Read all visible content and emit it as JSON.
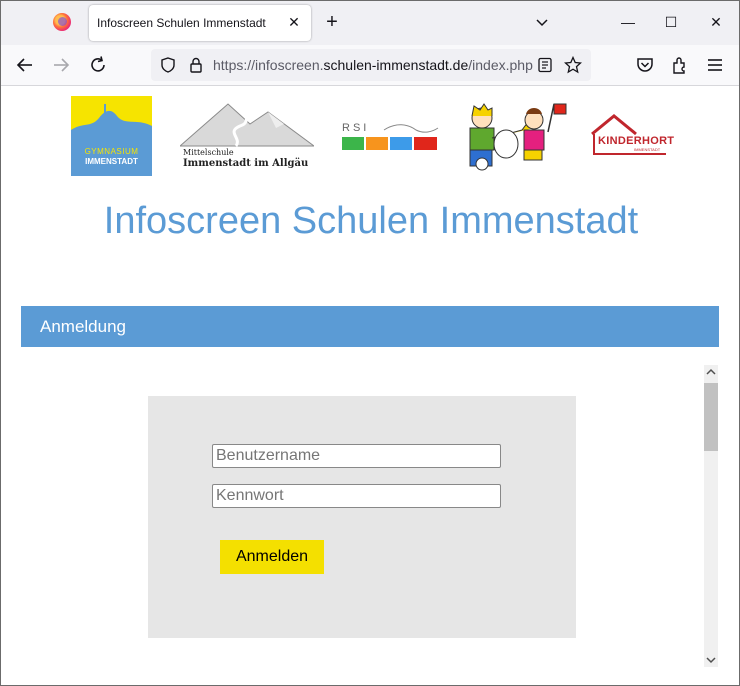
{
  "browser": {
    "tab_title": "Infoscreen Schulen Immenstadt",
    "tab_close": "✕",
    "new_tab": "+",
    "url_prefix": "https://infoscreen.",
    "url_domain": "schulen-immenstadt.de",
    "url_path": "/index.php",
    "window_min": "—",
    "window_max": "☐",
    "window_close": "✕"
  },
  "logos": {
    "gymnasium_line1": "GYMNASIUM",
    "gymnasium_line2": "IMMENSTADT",
    "mittelschule_line1": "Mittelschule",
    "mittelschule_line2": "Immenstadt im Allgäu",
    "rsi_text": "RSI",
    "kinderhort_line1": "KINDERHORT",
    "kinderhort_line2": "IMMENSTADT"
  },
  "page": {
    "title": "Infoscreen Schulen Immenstadt",
    "section_title": "Anmeldung"
  },
  "login": {
    "username_placeholder": "Benutzername",
    "password_placeholder": "Kennwort",
    "submit_label": "Anmelden"
  },
  "colors": {
    "accent_blue": "#5b9bd5",
    "button_yellow": "#f4e000",
    "panel_gray": "#e6e6e6"
  }
}
